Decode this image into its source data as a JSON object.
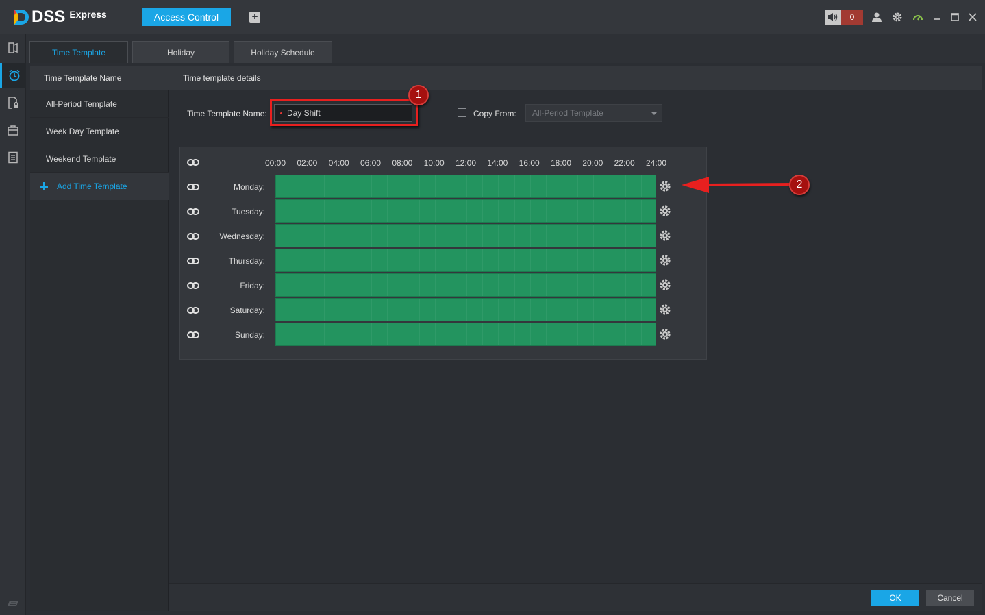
{
  "app": {
    "logo_text": "DSS",
    "logo_sub": "Express",
    "active_module": "Access Control",
    "add_tab_label": "+"
  },
  "titlebar": {
    "alarm_count": "0",
    "icons": [
      "speaker-icon",
      "user-icon",
      "gear-icon",
      "performance-icon",
      "minimize-icon",
      "maximize-icon",
      "close-icon"
    ]
  },
  "rail": {
    "icons": [
      "door-icon",
      "clock-icon",
      "lock-file-icon",
      "briefcase-icon",
      "document-icon",
      "keyboard-icon"
    ]
  },
  "tabs": [
    {
      "label": "Time Template",
      "active": true
    },
    {
      "label": "Holiday",
      "active": false
    },
    {
      "label": "Holiday Schedule",
      "active": false
    }
  ],
  "list": {
    "header": "Time Template Name",
    "items": [
      "All-Period Template",
      "Week Day Template",
      "Weekend Template"
    ],
    "add_label": "Add Time Template"
  },
  "details": {
    "header": "Time template details",
    "name_label": "Time Template Name:",
    "name_value": "Day Shift",
    "copy_label": "Copy From:",
    "copy_placeholder": "All-Period Template",
    "copy_checked": false
  },
  "schedule": {
    "hours": [
      "00:00",
      "02:00",
      "04:00",
      "06:00",
      "08:00",
      "10:00",
      "12:00",
      "14:00",
      "16:00",
      "18:00",
      "20:00",
      "22:00",
      "24:00"
    ],
    "days": [
      "Monday:",
      "Tuesday:",
      "Wednesday:",
      "Thursday:",
      "Friday:",
      "Saturday:",
      "Sunday:"
    ],
    "bar_color": "#23945f"
  },
  "annotations": {
    "badge1": "1",
    "badge2": "2",
    "highlight_color": "#e8201f"
  },
  "footer": {
    "ok_label": "OK",
    "cancel_label": "Cancel"
  }
}
